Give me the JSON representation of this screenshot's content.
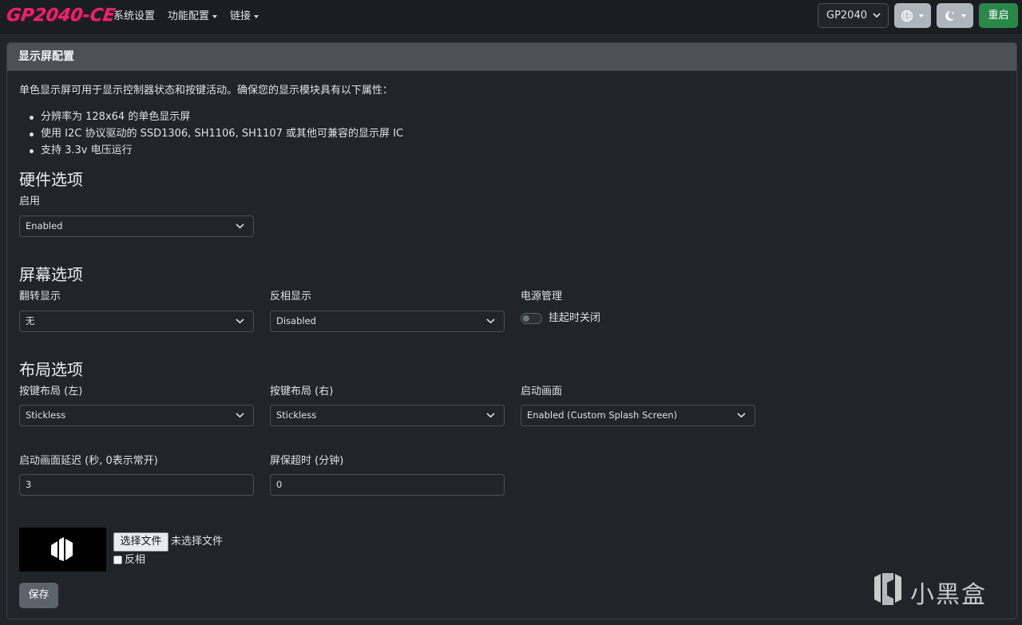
{
  "navbar": {
    "logo_text": "GP2040-CE",
    "links": [
      {
        "label": "系统设置",
        "has_dropdown": false
      },
      {
        "label": "功能配置",
        "has_dropdown": true
      },
      {
        "label": "链接",
        "has_dropdown": true
      }
    ],
    "board_select": {
      "value": "GP2040"
    },
    "language_icon": "globe-icon",
    "theme_icon": "moon-stars-icon",
    "restart_label": "重启"
  },
  "card": {
    "header": "显示屏配置",
    "description": "单色显示屏可用于显示控制器状态和按键活动。确保您的显示模块具有以下属性：",
    "requirements": [
      "分辨率为 128x64 的单色显示屏",
      "使用 I2C 协议驱动的 SSD1306, SH1106, SH1107 或其他可兼容的显示屏 IC",
      "支持 3.3v 电压运行"
    ],
    "hardware": {
      "title": "硬件选项",
      "enable_label": "启用",
      "enable_value": "Enabled"
    },
    "screen": {
      "title": "屏幕选项",
      "flip_label": "翻转显示",
      "flip_value": "无",
      "invert_label": "反相显示",
      "invert_value": "Disabled",
      "power_label": "电源管理",
      "power_toggle_label": "挂起时关闭",
      "power_toggle_on": false
    },
    "layout": {
      "title": "布局选项",
      "left_label": "按键布局 (左)",
      "left_value": "Stickless",
      "right_label": "按键布局 (右)",
      "right_value": "Stickless",
      "splash_label": "启动画面",
      "splash_value": "Enabled (Custom Splash Screen)",
      "splash_delay_label": "启动画面延迟 (秒, 0表示常开)",
      "splash_delay_value": "3",
      "saver_label": "屏保超时 (分钟)",
      "saver_value": "0"
    },
    "splash_image": {
      "file_button_label": "选择文件",
      "file_status": "未选择文件",
      "invert_label": "反相",
      "invert_checked": false
    },
    "save_label": "保存"
  },
  "watermark": {
    "text": "小黑盒"
  }
}
